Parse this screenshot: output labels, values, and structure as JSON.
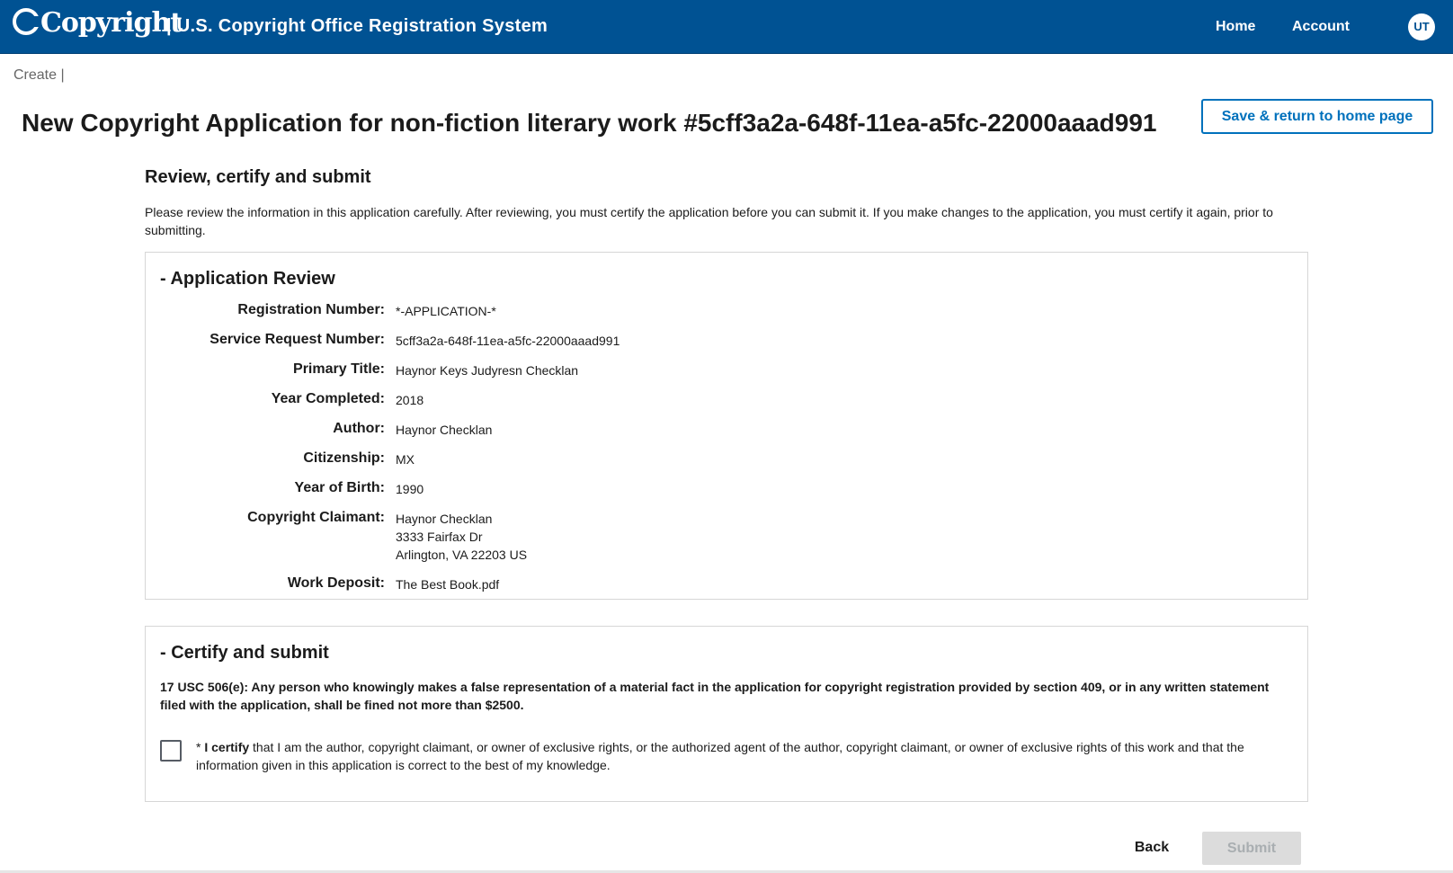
{
  "header": {
    "logo_text": "Copyright",
    "system_name": "| U.S. Copyright Office Registration System",
    "nav": {
      "home": "Home",
      "account": "Account"
    },
    "avatar_initials": "UT",
    "background_color": "#005293"
  },
  "breadcrumb": "Create |",
  "page": {
    "title": "New Copyright Application for non-fiction literary work #5cff3a2a-648f-11ea-a5fc-22000aaad991",
    "save_button": "Save & return to home page",
    "section_heading": "Review, certify and submit",
    "intro": "Please review the information in this application carefully. After reviewing, you must certify the application before you can submit it. If you make changes to the application, you must certify it again, prior to submitting."
  },
  "review": {
    "title": "- Application Review",
    "rows": [
      {
        "label": "Registration Number:",
        "value": "*-APPLICATION-*"
      },
      {
        "label": "Service Request Number:",
        "value": "5cff3a2a-648f-11ea-a5fc-22000aaad991"
      },
      {
        "label": "Primary Title:",
        "value": "Haynor Keys Judyresn Checklan"
      },
      {
        "label": "Year Completed:",
        "value": "2018"
      },
      {
        "label": "Author:",
        "value": "Haynor Checklan"
      },
      {
        "label": "Citizenship:",
        "value": "MX"
      },
      {
        "label": "Year of Birth:",
        "value": "1990"
      },
      {
        "label": "Copyright Claimant:",
        "lines": [
          "Haynor Checklan",
          "3333 Fairfax Dr",
          "Arlington, VA 22203 US"
        ]
      },
      {
        "label": "Work Deposit:",
        "value": "The Best Book.pdf"
      }
    ]
  },
  "certify": {
    "title": "- Certify and submit",
    "legal_notice": "17 USC 506(e): Any person who knowingly makes a false representation of a material fact in the application for copyright registration provided by section 409, or in any written statement filed with the application, shall be fined not more than $2500.",
    "checkbox_prefix": "* ",
    "checkbox_bold": "I certify",
    "checkbox_text": " that I am the author, copyright claimant, or owner of exclusive rights, or the authorized agent of the author, copyright claimant, or owner of exclusive rights of this work and that the information given in this application is correct to the best of my knowledge.",
    "checked": false
  },
  "actions": {
    "back": "Back",
    "submit": "Submit",
    "submit_disabled": true
  }
}
